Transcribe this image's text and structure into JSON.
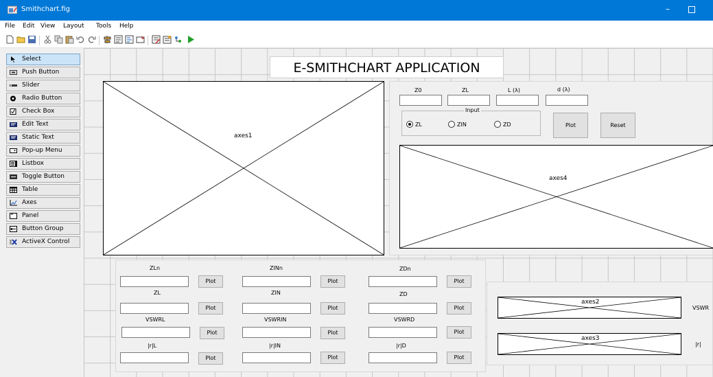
{
  "window": {
    "title": "Smithchart.fig",
    "minimize_glyph": "–"
  },
  "menu": [
    "File",
    "Edit",
    "View",
    "Layout",
    "Tools",
    "Help"
  ],
  "toolbar_icons": [
    "new-icon",
    "open-icon",
    "save-icon",
    "cut-icon",
    "copy-icon",
    "paste-icon",
    "undo-icon",
    "redo-icon",
    "align-icon",
    "menu-editor-icon",
    "tab-order-icon",
    "toolbar-editor-icon",
    "editor-icon",
    "property-inspector-icon",
    "object-browser-icon",
    "run-icon"
  ],
  "palette": [
    {
      "label": "Select",
      "icon": "arrow-icon"
    },
    {
      "label": "Push Button",
      "icon": "push-button-icon"
    },
    {
      "label": "Slider",
      "icon": "slider-icon"
    },
    {
      "label": "Radio Button",
      "icon": "radio-button-icon"
    },
    {
      "label": "Check Box",
      "icon": "check-box-icon"
    },
    {
      "label": "Edit Text",
      "icon": "edit-text-icon"
    },
    {
      "label": "Static Text",
      "icon": "static-text-icon"
    },
    {
      "label": "Pop-up Menu",
      "icon": "popup-menu-icon"
    },
    {
      "label": "Listbox",
      "icon": "listbox-icon"
    },
    {
      "label": "Toggle Button",
      "icon": "toggle-button-icon"
    },
    {
      "label": "Table",
      "icon": "table-icon"
    },
    {
      "label": "Axes",
      "icon": "axes-icon"
    },
    {
      "label": "Panel",
      "icon": "panel-icon"
    },
    {
      "label": "Button Group",
      "icon": "button-group-icon"
    },
    {
      "label": "ActiveX Control",
      "icon": "activex-icon"
    }
  ],
  "app_title": "E-SMITHCHART APPLICATION",
  "axes": {
    "axes1": "axes1",
    "axes2": "axes2",
    "axes3": "axes3",
    "axes4": "axes4"
  },
  "inputs": {
    "z0_label": "Z0",
    "zl_label": "ZL",
    "l_label": "L (λ)",
    "d_label": "d (λ)",
    "input_group": "Input",
    "radio_zl": "ZL",
    "radio_zin": "ZIN",
    "radio_zd": "ZD",
    "plot": "Plot",
    "reset": "Reset"
  },
  "bottom": {
    "zln": "ZLn",
    "zinn": "ZINn",
    "zdn": "ZDn",
    "zl": "ZL",
    "zin": "ZIN",
    "zd": "ZD",
    "vswrl": "VSWRL",
    "vswrin": "VSWRIN",
    "vswrd": "VSWRD",
    "gl": "|r|L",
    "gin": "|r|IN",
    "gd": "|r|D",
    "plot": "Plot",
    "vswr": "VSWR",
    "gamma": "|r|"
  },
  "colors": {
    "titlebar": "#0078d7",
    "selected": "#cce4f7",
    "run": "#22a02a"
  }
}
